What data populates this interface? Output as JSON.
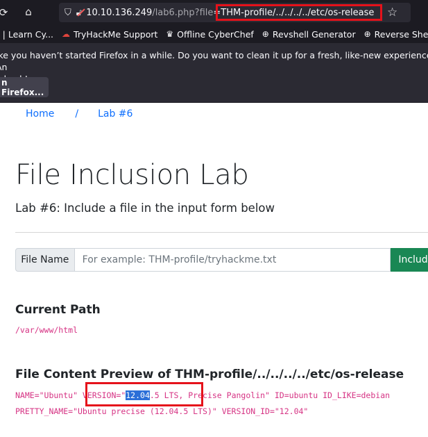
{
  "browser": {
    "url_host": "10.10.136.249",
    "url_path": "/lab6.php?file",
    "url_param": "=THM-profile/../../../../etc/os-release",
    "bookmarks": [
      {
        "icon": "globe-icon",
        "label": "e | Learn Cy..."
      },
      {
        "icon": "tryhackme-icon",
        "label": "TryHackMe Support"
      },
      {
        "icon": "chef-icon",
        "label": "Offline CyberChef"
      },
      {
        "icon": "globe-icon",
        "label": "Revshell Generator"
      },
      {
        "icon": "globe-icon",
        "label": "Reverse Shell"
      }
    ],
    "notice_line1": "ike you haven’t started Firefox in a while. Do you want to clean it up for a fresh, like-new experience? An",
    "notice_line2": "e back!",
    "refresh_label": "n Firefox..."
  },
  "page": {
    "breadcrumb": {
      "home": "Home",
      "separator": "/",
      "current": "Lab #6"
    },
    "title": "File Inclusion Lab",
    "subtitle": "Lab #6: Include a file in the input form below",
    "form": {
      "label": "File Name",
      "placeholder": "For example: THM-profile/tryhackme.txt",
      "button": "Include"
    },
    "current_path_heading": "Current Path",
    "current_path": "/var/www/html",
    "preview_heading_prefix": "File Content Preview of ",
    "preview_heading_file": "THM-profile/../../../../etc/os-release",
    "preview_line1_a": "NAME=\"Ubuntu\" VERSION=\"",
    "preview_line1_sel": "12.04",
    "preview_line1_b": ".5 LTS, Precise Pangolin\" ID=ubuntu ID_LIKE=debian",
    "preview_line2": "PRETTY_NAME=\"Ubuntu precise (12.04.5 LTS)\" VERSION_ID=\"12.04\""
  },
  "colors": {
    "highlight_box": "#e5121b",
    "link": "#0d6efd",
    "code": "#d63384",
    "button": "#198754"
  }
}
